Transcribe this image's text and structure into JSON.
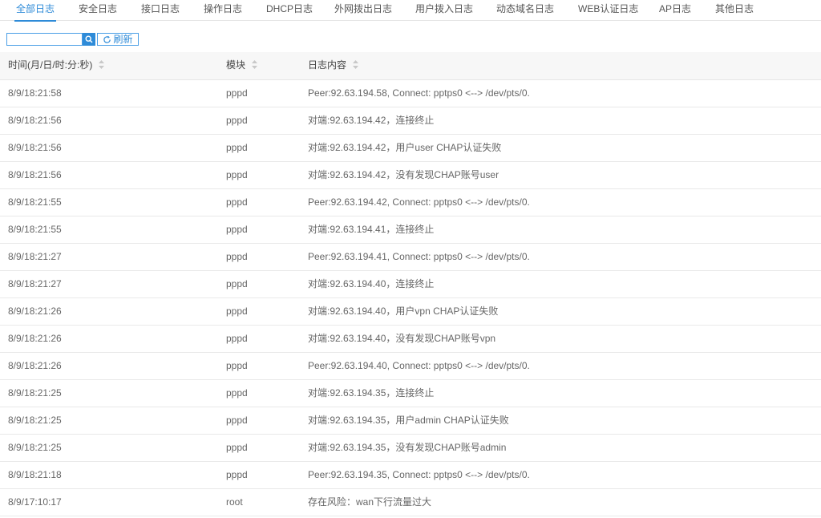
{
  "tabs": [
    {
      "label": "全部日志",
      "active": true
    },
    {
      "label": "安全日志",
      "active": false
    },
    {
      "label": "接口日志",
      "active": false
    },
    {
      "label": "操作日志",
      "active": false
    },
    {
      "label": "DHCP日志",
      "active": false
    },
    {
      "label": "外网拨出日志",
      "active": false
    },
    {
      "label": "用户拨入日志",
      "active": false
    },
    {
      "label": "动态域名日志",
      "active": false
    },
    {
      "label": "WEB认证日志",
      "active": false
    },
    {
      "label": "AP日志",
      "active": false
    },
    {
      "label": "其他日志",
      "active": false
    }
  ],
  "toolbar": {
    "search_value": "",
    "search_icon": "search-icon",
    "refresh_icon": "refresh-icon",
    "refresh_label": "刷新"
  },
  "table": {
    "columns": [
      "时间(月/日/时:分:秒)",
      "模块",
      "日志内容"
    ],
    "rows": [
      [
        "8/9/18:21:58",
        "pppd",
        "Peer:92.63.194.58, Connect: pptps0 <--> /dev/pts/0."
      ],
      [
        "8/9/18:21:56",
        "pppd",
        "对端:92.63.194.42，连接终止"
      ],
      [
        "8/9/18:21:56",
        "pppd",
        "对端:92.63.194.42，用户user CHAP认证失败"
      ],
      [
        "8/9/18:21:56",
        "pppd",
        "对端:92.63.194.42，没有发现CHAP账号user"
      ],
      [
        "8/9/18:21:55",
        "pppd",
        "Peer:92.63.194.42, Connect: pptps0 <--> /dev/pts/0."
      ],
      [
        "8/9/18:21:55",
        "pppd",
        "对端:92.63.194.41，连接终止"
      ],
      [
        "8/9/18:21:27",
        "pppd",
        "Peer:92.63.194.41, Connect: pptps0 <--> /dev/pts/0."
      ],
      [
        "8/9/18:21:27",
        "pppd",
        "对端:92.63.194.40，连接终止"
      ],
      [
        "8/9/18:21:26",
        "pppd",
        "对端:92.63.194.40，用户vpn CHAP认证失败"
      ],
      [
        "8/9/18:21:26",
        "pppd",
        "对端:92.63.194.40，没有发现CHAP账号vpn"
      ],
      [
        "8/9/18:21:26",
        "pppd",
        "Peer:92.63.194.40, Connect: pptps0 <--> /dev/pts/0."
      ],
      [
        "8/9/18:21:25",
        "pppd",
        "对端:92.63.194.35，连接终止"
      ],
      [
        "8/9/18:21:25",
        "pppd",
        "对端:92.63.194.35，用户admin CHAP认证失败"
      ],
      [
        "8/9/18:21:25",
        "pppd",
        "对端:92.63.194.35，没有发现CHAP账号admin"
      ],
      [
        "8/9/18:21:18",
        "pppd",
        "Peer:92.63.194.35, Connect: pptps0 <--> /dev/pts/0."
      ],
      [
        "8/9/17:10:17",
        "root",
        "存在风险：wan下行流量过大"
      ]
    ]
  },
  "colors": {
    "accent": "#2e8bd8",
    "header_bg": "#f7f7f7",
    "row_border": "#e9e9e9"
  }
}
